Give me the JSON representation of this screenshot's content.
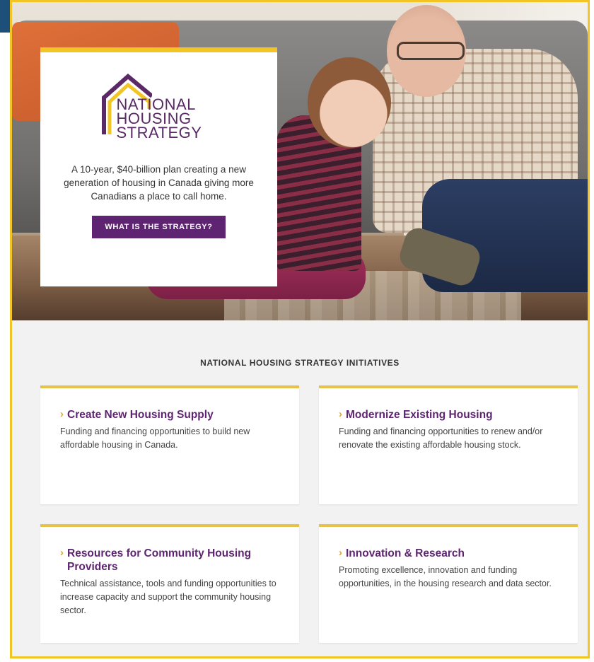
{
  "hero": {
    "logo_lines": [
      "NATIONAL",
      "HOUSING",
      "STRATEGY"
    ],
    "description": "A 10-year, $40-billion plan creating a new generation of housing in Canada giving more Canadians a place to call home.",
    "cta_label": "WHAT IS THE STRATEGY?"
  },
  "section": {
    "title": "NATIONAL HOUSING STRATEGY INITIATIVES"
  },
  "cards": [
    {
      "title": "Create New Housing Supply",
      "description": "Funding and financing opportunities to build new affordable housing in Canada."
    },
    {
      "title": "Modernize Existing Housing",
      "description": "Funding and financing opportunities to renew and/or renovate the existing affordable housing stock."
    },
    {
      "title": "Resources for Community Housing Providers",
      "description": "Technical assistance, tools and funding opportunities to increase capacity and support the community housing sector."
    },
    {
      "title": "Innovation & Research",
      "description": "Promoting excellence, innovation and funding opportunities, in the housing research and data sector."
    }
  ],
  "colors": {
    "brand_purple": "#5e2471",
    "accent_gold": "#f2c424",
    "frame_border": "#f2c424",
    "corner_blue": "#1c4f7a"
  },
  "icons": {
    "logo": "house-outline-icon",
    "card_bullet": "chevron-right-icon"
  }
}
